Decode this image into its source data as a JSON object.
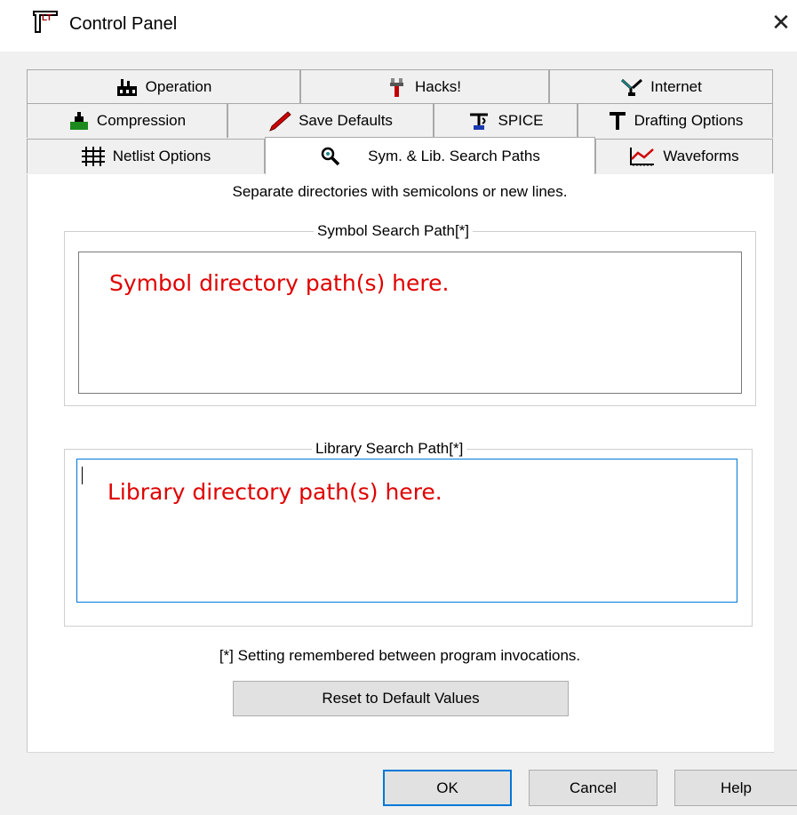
{
  "window": {
    "title": "Control Panel",
    "close_glyph": "✕"
  },
  "tabs_row1": [
    {
      "label": "Operation",
      "icon": "factory-icon"
    },
    {
      "label": "Hacks!",
      "icon": "tool-icon"
    },
    {
      "label": "Internet",
      "icon": "network-icon"
    }
  ],
  "tabs_row2": [
    {
      "label": "Compression",
      "icon": "compress-icon"
    },
    {
      "label": "Save Defaults",
      "icon": "pencil-icon"
    },
    {
      "label": "SPICE",
      "icon": "spice-icon"
    },
    {
      "label": "Drafting Options",
      "icon": "t-icon"
    }
  ],
  "tabs_row3": [
    {
      "label": "Netlist Options",
      "icon": "grid-icon"
    },
    {
      "label": "Sym. & Lib. Search Paths",
      "icon": "magnifier-icon",
      "active": true
    },
    {
      "label": "Waveforms",
      "icon": "waveform-icon"
    }
  ],
  "content": {
    "hint": "Separate directories with semicolons or new lines.",
    "symbol_group_label": "Symbol Search Path[*]",
    "symbol_path_text": "Symbol directory path(s) here.",
    "library_group_label": "Library Search Path[*]",
    "library_path_text": "Library directory path(s) here.",
    "note": "[*] Setting remembered between program invocations.",
    "reset_label": "Reset to Default Values"
  },
  "footer": {
    "ok_label": "OK",
    "cancel_label": "Cancel",
    "help_label": "Help"
  },
  "colors": {
    "annotation_red": "#e00000",
    "focus_blue": "#0078d7"
  }
}
